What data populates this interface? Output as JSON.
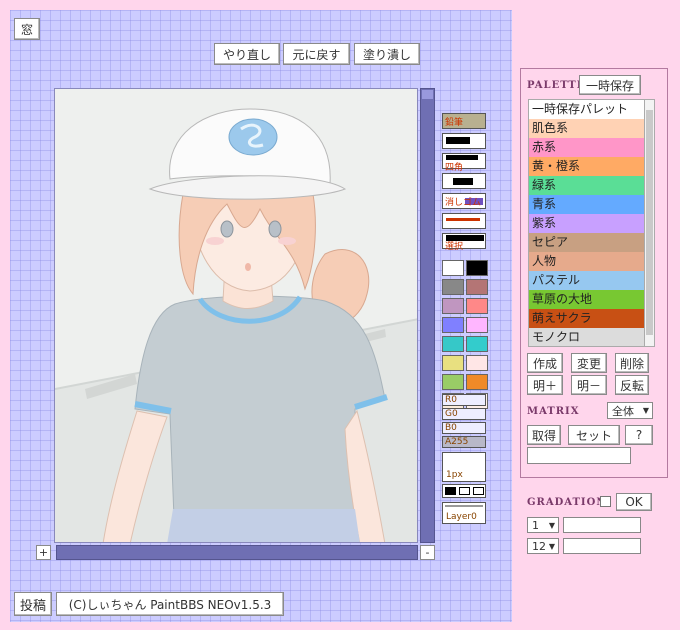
{
  "window_button": "窓",
  "toolbar": {
    "redo": "やり直し",
    "undo": "元に戻す",
    "fill": "塗り潰し"
  },
  "tools": [
    "鉛筆",
    "",
    "四角",
    "",
    "消しゴム",
    "",
    "選択"
  ],
  "swatches": [
    "#ffffff",
    "#000000",
    "#888888",
    "#b47575",
    "#c096c0",
    "#ff8888",
    "#8080ff",
    "#ffb6ff",
    "#36c8c8",
    "#33cccc",
    "#e8e080",
    "#ffe6e6",
    "#99cc66",
    "#f08a28",
    "#fcecdc",
    "#fff0e8"
  ],
  "rgba": [
    "R0",
    "G0",
    "B0",
    "A255"
  ],
  "brush_size": "1px",
  "layer": "Layer0",
  "scroll": {
    "plus": "+",
    "minus": "-"
  },
  "footer": {
    "post": "投稿",
    "credit": "(C)しぃちゃん PaintBBS NEOv1.5.3"
  },
  "palette": {
    "title": "PALETTE",
    "temp_save": "一時保存",
    "items": [
      {
        "label": "一時保存パレット",
        "color": "#ffffff"
      },
      {
        "label": "肌色系",
        "color": "#ffd2b4"
      },
      {
        "label": "赤系",
        "color": "#ff96c8"
      },
      {
        "label": "黄・橙系",
        "color": "#ffaa64"
      },
      {
        "label": "緑系",
        "color": "#5ade96"
      },
      {
        "label": "青系",
        "color": "#64aaff"
      },
      {
        "label": "紫系",
        "color": "#c8a0ff"
      },
      {
        "label": "セピア",
        "color": "#c8a082"
      },
      {
        "label": "人物",
        "color": "#e6aa8c"
      },
      {
        "label": "パステル",
        "color": "#96c8f0"
      },
      {
        "label": "草原の大地",
        "color": "#78c832"
      },
      {
        "label": "萌えサクラ",
        "color": "#c85014"
      },
      {
        "label": "モノクロ",
        "color": "#dcdcdc"
      }
    ],
    "buttons": {
      "create": "作成",
      "change": "変更",
      "delete": "削除",
      "brighter": "明＋",
      "darker": "明－",
      "invert": "反転"
    }
  },
  "matrix": {
    "title": "MATRIX",
    "scope": "全体",
    "get": "取得",
    "set": "セット",
    "help": "?"
  },
  "gradation": {
    "title": "GRADATION",
    "ok": "OK",
    "select1": "1",
    "select2": "12"
  }
}
